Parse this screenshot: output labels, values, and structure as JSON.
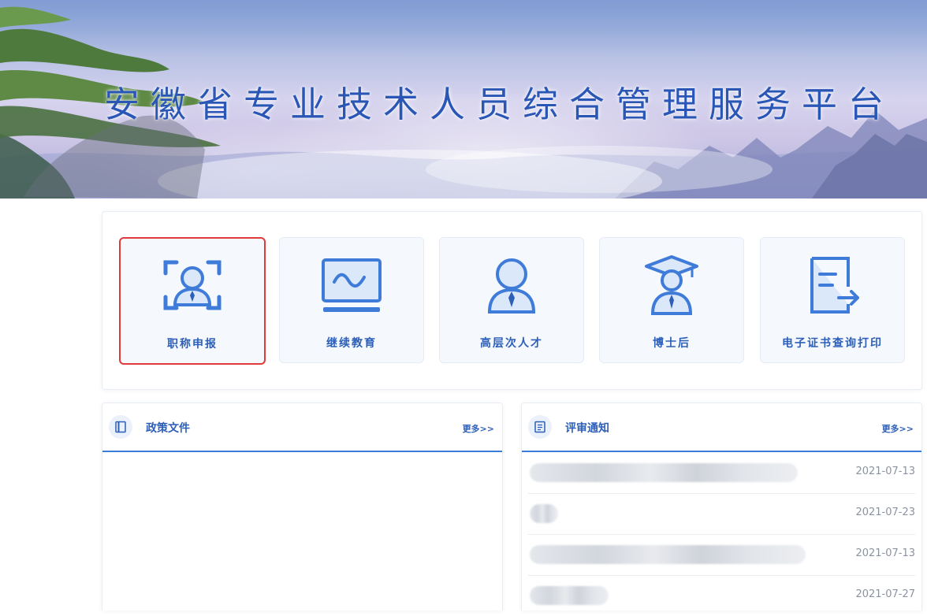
{
  "banner": {
    "title": "安徽省专业技术人员综合管理服务平台"
  },
  "services": [
    {
      "label": "职称申报",
      "icon": "person-scan-icon",
      "selected": true
    },
    {
      "label": "继续教育",
      "icon": "monitor-icon",
      "selected": false
    },
    {
      "label": "高层次人才",
      "icon": "person-icon",
      "selected": false
    },
    {
      "label": "博士后",
      "icon": "graduate-icon",
      "selected": false
    },
    {
      "label": "电子证书查询打印",
      "icon": "document-export-icon",
      "selected": false
    }
  ],
  "policy": {
    "title": "政策文件",
    "more": "更多>>",
    "icon": "book-icon"
  },
  "notices": {
    "title": "评审通知",
    "more": "更多>>",
    "icon": "list-doc-icon",
    "items": [
      {
        "date": "2021-07-13"
      },
      {
        "date": "2021-07-23"
      },
      {
        "date": "2021-07-13"
      },
      {
        "date": "2021-07-27"
      }
    ]
  },
  "colors": {
    "accent": "#2d5fb8",
    "title": "#2a56b6",
    "selected_border": "#e03a3a"
  }
}
